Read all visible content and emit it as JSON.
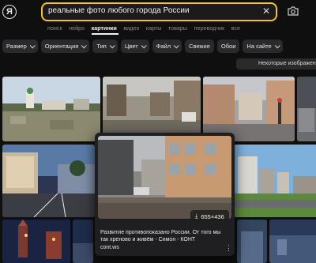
{
  "logo": "Я",
  "search": {
    "query": "реальные фото любого города России"
  },
  "tabs": [
    {
      "label": "поиск"
    },
    {
      "label": "нейро"
    },
    {
      "label": "картинки",
      "active": true
    },
    {
      "label": "видео"
    },
    {
      "label": "карты"
    },
    {
      "label": "товары"
    },
    {
      "label": "переводчик"
    },
    {
      "label": "все"
    }
  ],
  "filters": [
    {
      "label": "Размер",
      "dropdown": true
    },
    {
      "label": "Ориентация",
      "dropdown": true
    },
    {
      "label": "Тип",
      "dropdown": true
    },
    {
      "label": "Цвет",
      "dropdown": true
    },
    {
      "label": "Файл",
      "dropdown": true
    },
    {
      "label": "Свежие",
      "dropdown": false
    },
    {
      "label": "Обои",
      "dropdown": false
    },
    {
      "label": "На сайте",
      "dropdown": true
    }
  ],
  "hint": "Некоторые изображения",
  "card": {
    "size": "655×436",
    "title": "Развитие противопоказано России. От того мы так хреново и живём - Симон - КОНТ",
    "source": "cont.ws"
  },
  "colors": {
    "accent": "#f7c21a",
    "background": "#0f0f10",
    "chip": "#2a2a2d"
  }
}
